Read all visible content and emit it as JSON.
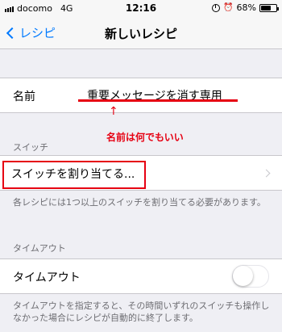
{
  "status_bar": {
    "carrier": "docomo",
    "network": "4G",
    "time": "12:16",
    "battery": "68%",
    "battery_level": 0.68
  },
  "nav": {
    "back_label": "レシピ",
    "title": "新しいレシピ"
  },
  "name_row": {
    "label": "名前",
    "value": "重要メッセージを消す専用"
  },
  "annotation": {
    "arrow": "↑",
    "text": "名前は何でもいい"
  },
  "switch_section": {
    "header": "スイッチ",
    "assign_label": "スイッチを割り当てる...",
    "footer": "各レシピには1つ以上のスイッチを割り当てる必要があります。"
  },
  "timeout_section": {
    "header": "タイムアウト",
    "label": "タイムアウト",
    "toggle_on": false,
    "footer": "タイムアウトを指定すると、その時間いずれのスイッチも操作しなかった場合にレシピが自動的に終了します。"
  },
  "colors": {
    "accent": "#007aff",
    "annotation": "#e60012",
    "background": "#efeff4"
  }
}
